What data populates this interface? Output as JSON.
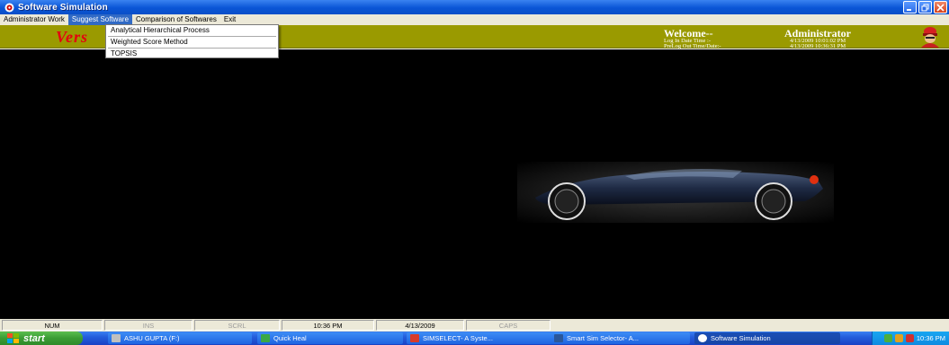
{
  "window": {
    "title": "Software Simulation"
  },
  "menubar": {
    "items": [
      {
        "label": "Administrator Work"
      },
      {
        "label": "Suggest Software"
      },
      {
        "label": "Comparison of Softwares"
      },
      {
        "label": "Exit"
      }
    ]
  },
  "dropdown": {
    "items": [
      {
        "label": "Analytical Hierarchical Process"
      },
      {
        "label": "Weighted Score Method"
      },
      {
        "label": "TOPSIS"
      }
    ]
  },
  "header": {
    "logo_text": "Vers",
    "welcome": "Welcome--",
    "user": "Administrator",
    "login_label": "Log In Date Time :-",
    "login_value": "4/13/2009 10:01:02 PM",
    "prelogout_label": "PreLog Out Time/Date:-",
    "prelogout_value": "4/13/2009 10:36:31 PM"
  },
  "statusbar": {
    "num": "NUM",
    "ins": "INS",
    "scrl": "SCRL",
    "time": "10:36 PM",
    "date": "4/13/2009",
    "caps": "CAPS"
  },
  "taskbar": {
    "start_label": "start",
    "tasks": [
      {
        "label": "ASHU GUPTA (F:)"
      },
      {
        "label": "Quick Heal"
      },
      {
        "label": "SIMSELECT- A Syste..."
      },
      {
        "label": "Smart Sim Selector- A..."
      },
      {
        "label": "Software Simulation"
      }
    ],
    "clock": "10:36 PM"
  },
  "colors": {
    "header_bg": "#9a9a00",
    "logo_red": "#e4000f",
    "menu_highlight": "#316ac5"
  }
}
